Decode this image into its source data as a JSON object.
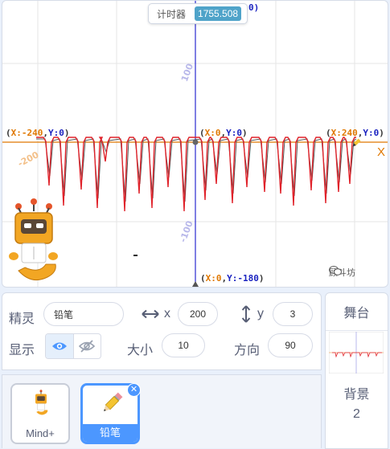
{
  "stage": {
    "timer_label": "计时器",
    "timer_value": "1755.508",
    "timer_tail": "0)",
    "coord_left": {
      "x": "X:-240",
      "y": "Y:0"
    },
    "coord_center": {
      "x": "X:0",
      "y": "Y:0"
    },
    "coord_right": {
      "x": "X:240",
      "y": "Y:0"
    },
    "coord_bottom": {
      "x": "X:0",
      "y": "Y:-180"
    },
    "tick_y_pos": "100",
    "tick_y_neg": "-100",
    "tick_x_neg": "-200",
    "axis_x_letter": "X",
    "watermark": "顾斗坊"
  },
  "sprite_info": {
    "sprite_label": "精灵",
    "sprite_name": "铅笔",
    "x_label": "x",
    "x_value": "200",
    "y_label": "y",
    "y_value": "3",
    "show_label": "显示",
    "size_label": "大小",
    "size_value": "10",
    "direction_label": "方向",
    "direction_value": "90"
  },
  "stage_selector": {
    "header": "舞台",
    "backdrop_label": "背景",
    "backdrop_count": "2"
  },
  "sprites": [
    {
      "name": "Mind+"
    },
    {
      "name": "铅笔"
    }
  ],
  "colors": {
    "accent": "#4c97ff",
    "stroke": "#e0222a",
    "axis": "#2a2ad0",
    "axis_x": "#e07800"
  },
  "icons": {
    "show": "eye-icon",
    "hide": "eye-off-icon",
    "pencil": "pencil-icon",
    "delete": "close-icon",
    "robot": "robot-icon"
  }
}
